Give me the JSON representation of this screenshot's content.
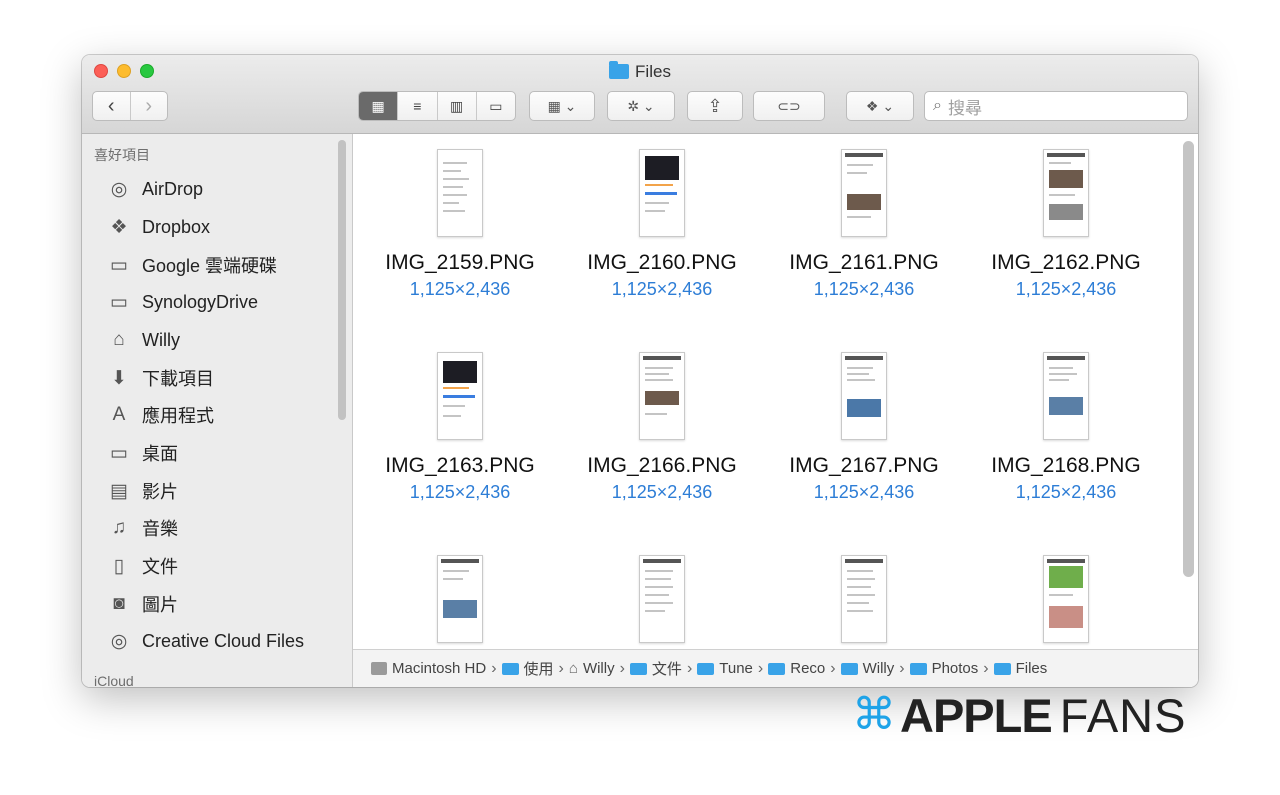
{
  "window": {
    "title": "Files"
  },
  "toolbar": {
    "back": "‹",
    "forward": "›",
    "views": [
      "▦",
      "≡",
      "▥",
      "▭"
    ],
    "group_icon": "▦ ⌄",
    "action_icon": "✲ ⌄",
    "share_icon": "⇪",
    "tag_icon": "⊂⊃",
    "dropbox_icon": "❖ ⌄",
    "search_placeholder": "搜尋"
  },
  "sidebar": {
    "header": "喜好項目",
    "header2": "iCloud",
    "items": [
      {
        "icon": "airdrop-icon",
        "glyph": "◎",
        "label": "AirDrop"
      },
      {
        "icon": "dropbox-icon",
        "glyph": "❖",
        "label": "Dropbox"
      },
      {
        "icon": "folder-icon",
        "glyph": "▭",
        "label": "Google 雲端硬碟"
      },
      {
        "icon": "folder-icon",
        "glyph": "▭",
        "label": "SynologyDrive"
      },
      {
        "icon": "home-icon",
        "glyph": "⌂",
        "label": "Willy"
      },
      {
        "icon": "download-icon",
        "glyph": "⬇",
        "label": "下載項目"
      },
      {
        "icon": "applications-icon",
        "glyph": "A",
        "label": "應用程式"
      },
      {
        "icon": "desktop-icon",
        "glyph": "▭",
        "label": "桌面"
      },
      {
        "icon": "movies-icon",
        "glyph": "▤",
        "label": "影片"
      },
      {
        "icon": "music-icon",
        "glyph": "♫",
        "label": "音樂"
      },
      {
        "icon": "documents-icon",
        "glyph": "▯",
        "label": "文件"
      },
      {
        "icon": "pictures-icon",
        "glyph": "◙",
        "label": "圖片"
      },
      {
        "icon": "creative-cloud-icon",
        "glyph": "◎",
        "label": "Creative Cloud Files"
      }
    ]
  },
  "files": [
    {
      "name": "IMG_2159.PNG",
      "dims": "1,125×2,436"
    },
    {
      "name": "IMG_2160.PNG",
      "dims": "1,125×2,436"
    },
    {
      "name": "IMG_2161.PNG",
      "dims": "1,125×2,436"
    },
    {
      "name": "IMG_2162.PNG",
      "dims": "1,125×2,436"
    },
    {
      "name": "IMG_2163.PNG",
      "dims": "1,125×2,436"
    },
    {
      "name": "IMG_2166.PNG",
      "dims": "1,125×2,436"
    },
    {
      "name": "IMG_2167.PNG",
      "dims": "1,125×2,436"
    },
    {
      "name": "IMG_2168.PNG",
      "dims": "1,125×2,436"
    }
  ],
  "pathbar": {
    "items": [
      "Macintosh HD",
      "使用",
      "Willy",
      "文件",
      "Tune",
      "Reco",
      "Willy",
      "Photos",
      "Files"
    ],
    "separator": "›"
  },
  "watermark": {
    "brand_a": "APPLE",
    "brand_b": "FANS"
  },
  "colors": {
    "accent": "#2d7dd6",
    "folder": "#39a3e8",
    "brand_icon": "#1ea3e8"
  }
}
